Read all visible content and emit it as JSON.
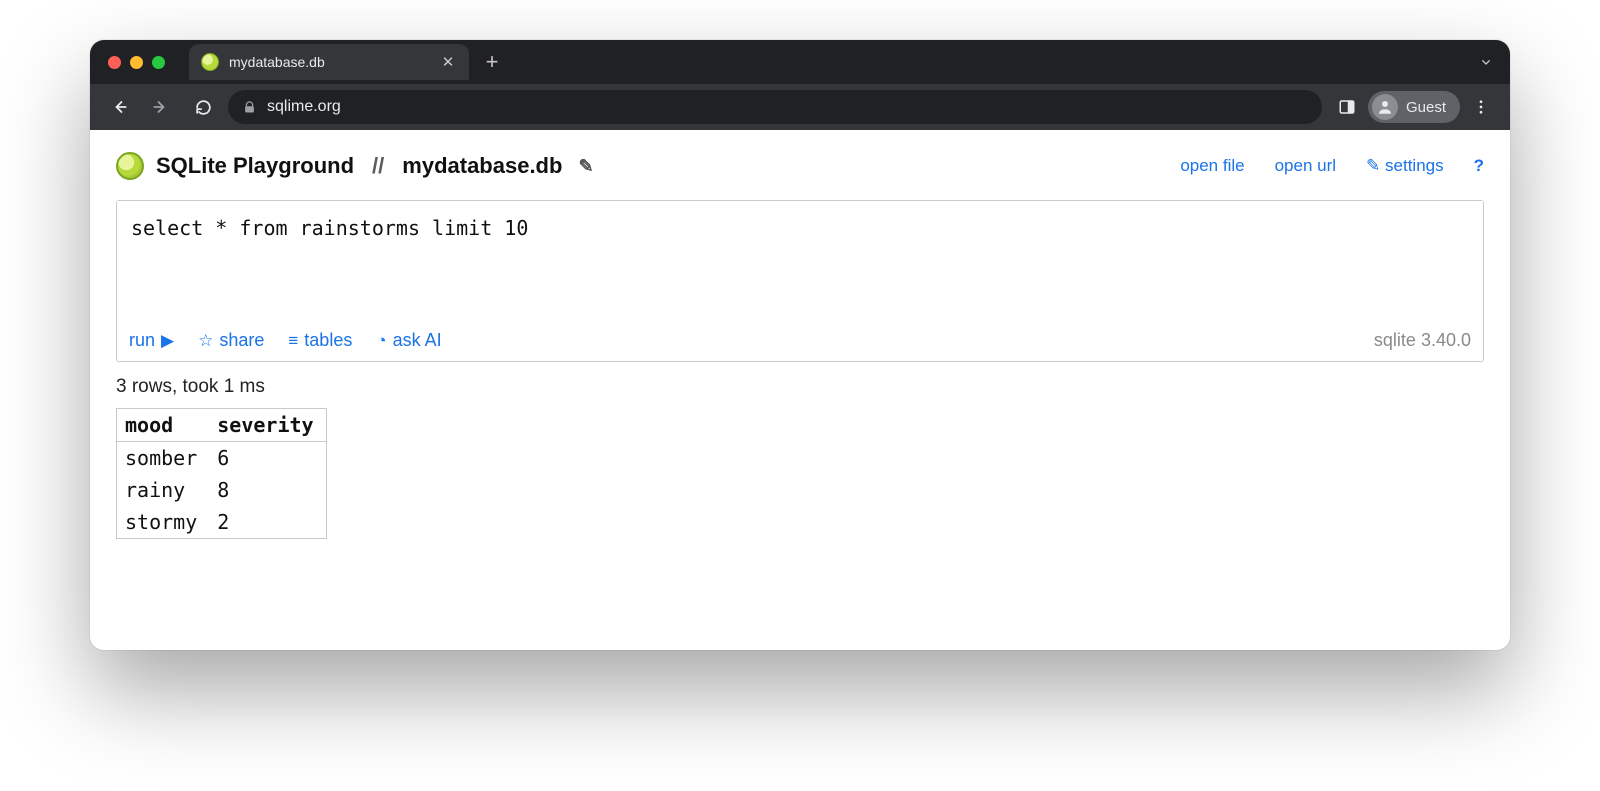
{
  "browser": {
    "tab_title": "mydatabase.db",
    "url": "sqlime.org",
    "profile_label": "Guest"
  },
  "header": {
    "app_name": "SQLite Playground",
    "separator": "//",
    "db_name": "mydatabase.db",
    "links": {
      "open_file": "open file",
      "open_url": "open url",
      "settings": "settings",
      "help": "?"
    }
  },
  "editor": {
    "query": "select * from rainstorms limit 10",
    "actions": {
      "run": "run",
      "share": "share",
      "tables": "tables",
      "ask_ai": "ask AI"
    },
    "version": "sqlite 3.40.0"
  },
  "result": {
    "status": "3 rows, took 1 ms",
    "columns": [
      "mood",
      "severity"
    ],
    "rows": [
      {
        "mood": "somber",
        "severity": 6
      },
      {
        "mood": "rainy",
        "severity": 8
      },
      {
        "mood": "stormy",
        "severity": 2
      }
    ]
  }
}
